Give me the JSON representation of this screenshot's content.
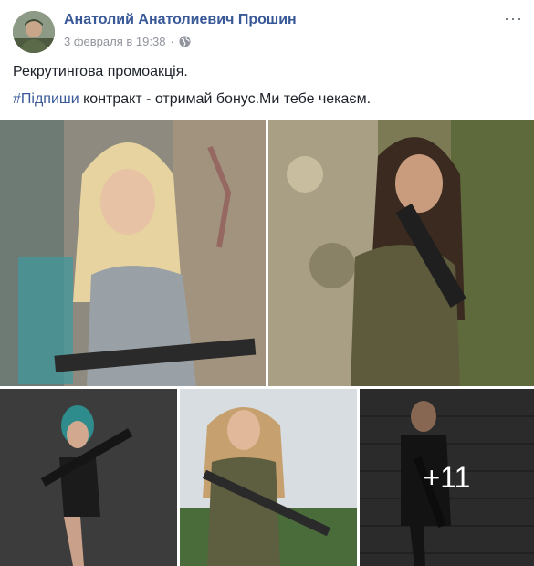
{
  "post": {
    "author": "Анатолий Анатолиевич Прошин",
    "date": "3 февраля в 19:38",
    "separator": "·",
    "privacy_icon": "globe-icon",
    "more_icon": "more-options-icon",
    "more_label": "···",
    "text_line1": "Рекрутингова промоакція.",
    "hashtag": "#Підпиши",
    "text_line2_rest": " контракт - отримай бонус.Ми тебе чекаєм."
  },
  "gallery": {
    "more_count": "+11",
    "photos": [
      {
        "subject": "blonde-woman-grey-tank-top-rifle"
      },
      {
        "subject": "brunette-woman-camouflage-rifle"
      },
      {
        "subject": "woman-teal-hair-bodysuit-rifle"
      },
      {
        "subject": "woman-olive-dress-rifle"
      },
      {
        "subject": "woman-black-dress-rifle"
      }
    ]
  },
  "colors": {
    "link": "#385898",
    "text": "#1d2129",
    "meta": "#90949c"
  }
}
